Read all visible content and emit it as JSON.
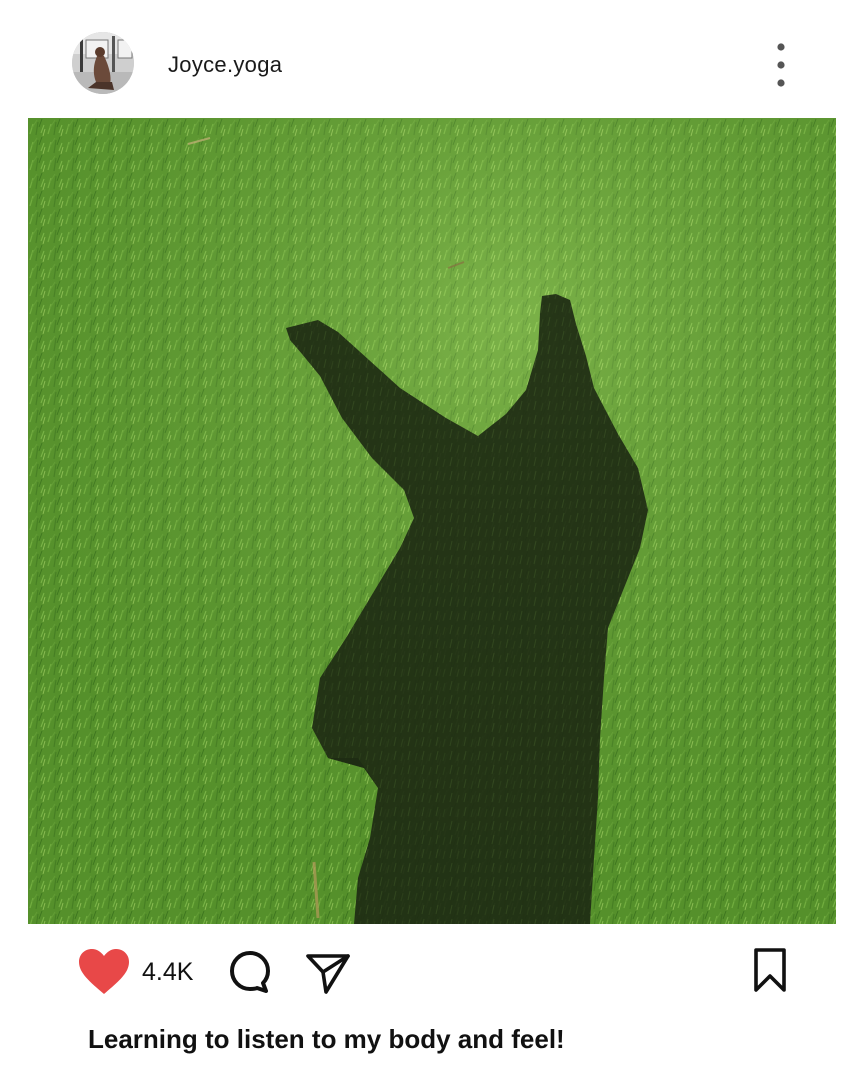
{
  "post": {
    "username": "Joyce.yoga",
    "likes": "4.4K",
    "caption": "Learning to listen to my body and feel!"
  },
  "icons": {
    "avatar": "avatar",
    "more": "vertical-ellipsis-icon",
    "like": "heart-icon",
    "comment": "comment-bubble-icon",
    "share": "paper-plane-icon",
    "save": "bookmark-icon"
  },
  "colors": {
    "heart": "#e84848",
    "grass": "#5f9a33",
    "shadow": "#1c2a12"
  }
}
